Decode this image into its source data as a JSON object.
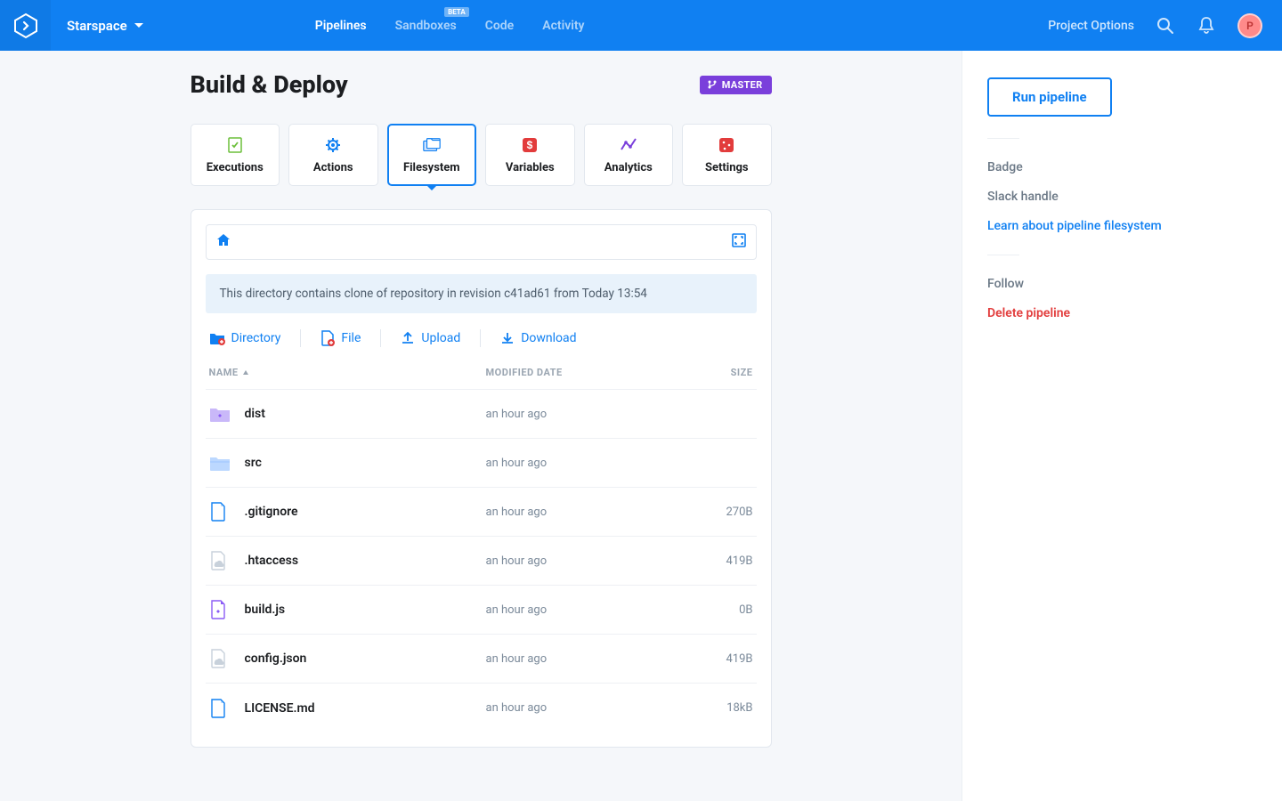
{
  "header": {
    "project_name": "Starspace",
    "tabs": {
      "pipelines": "Pipelines",
      "sandboxes": "Sandboxes",
      "sandboxes_badge": "BETA",
      "code": "Code",
      "activity": "Activity"
    },
    "right_link": "Project Options",
    "avatar_initial": "P"
  },
  "page": {
    "title": "Build & Deploy",
    "branch_label": "MASTER"
  },
  "section_tabs": {
    "executions": "Executions",
    "actions": "Actions",
    "filesystem": "Filesystem",
    "variables": "Variables",
    "analytics": "Analytics",
    "settings": "Settings"
  },
  "filesystem": {
    "info_text": "This directory contains clone of repository in revision c41ad61 from Today 13:54",
    "actions": {
      "directory": "Directory",
      "file": "File",
      "upload": "Upload",
      "download": "Download"
    },
    "columns": {
      "name": "NAME",
      "modified": "MODIFIED DATE",
      "size": "SIZE"
    },
    "rows": [
      {
        "icon": "folder-purple",
        "name": "dist",
        "date": "an hour ago",
        "size": ""
      },
      {
        "icon": "folder-blue",
        "name": "src",
        "date": "an hour ago",
        "size": ""
      },
      {
        "icon": "file",
        "name": ".gitignore",
        "date": "an hour ago",
        "size": "270B"
      },
      {
        "icon": "file-cloud",
        "name": ".htaccess",
        "date": "an hour ago",
        "size": "419B"
      },
      {
        "icon": "file-purple",
        "name": "build.js",
        "date": "an hour ago",
        "size": "0B"
      },
      {
        "icon": "file-cloud",
        "name": "config.json",
        "date": "an hour ago",
        "size": "419B"
      },
      {
        "icon": "file",
        "name": "LICENSE.md",
        "date": "an hour ago",
        "size": "18kB"
      }
    ]
  },
  "sidebar": {
    "run_button": "Run pipeline",
    "links1": [
      "Badge",
      "Slack handle",
      "Learn about pipeline filesystem"
    ],
    "follow": "Follow",
    "delete": "Delete pipeline"
  }
}
